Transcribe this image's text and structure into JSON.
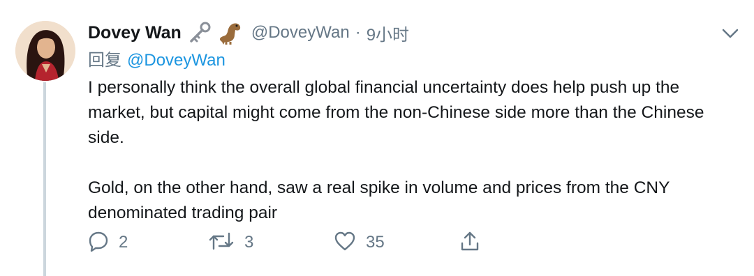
{
  "tweet": {
    "author_name": "Dovey Wan",
    "author_handle": "@DoveyWan",
    "separator": "·",
    "time": "9小时",
    "reply_prefix": "回复",
    "reply_to": "@DoveyWan",
    "text": "I personally think the overall global financial uncertainty does help push up the market, but capital might come from the non-Chinese side more than the Chinese side.\n\nGold, on the other hand, saw a real spike in volume and prices from the CNY denominated trading pair",
    "badges": [
      "key-emoji-icon",
      "dinosaur-emoji-icon"
    ]
  },
  "actions": {
    "reply_count": "2",
    "retweet_count": "3",
    "like_count": "35"
  },
  "colors": {
    "text": "#14171a",
    "secondary": "#657786",
    "link": "#1b95e0",
    "thread_line": "#ccd6dd"
  }
}
